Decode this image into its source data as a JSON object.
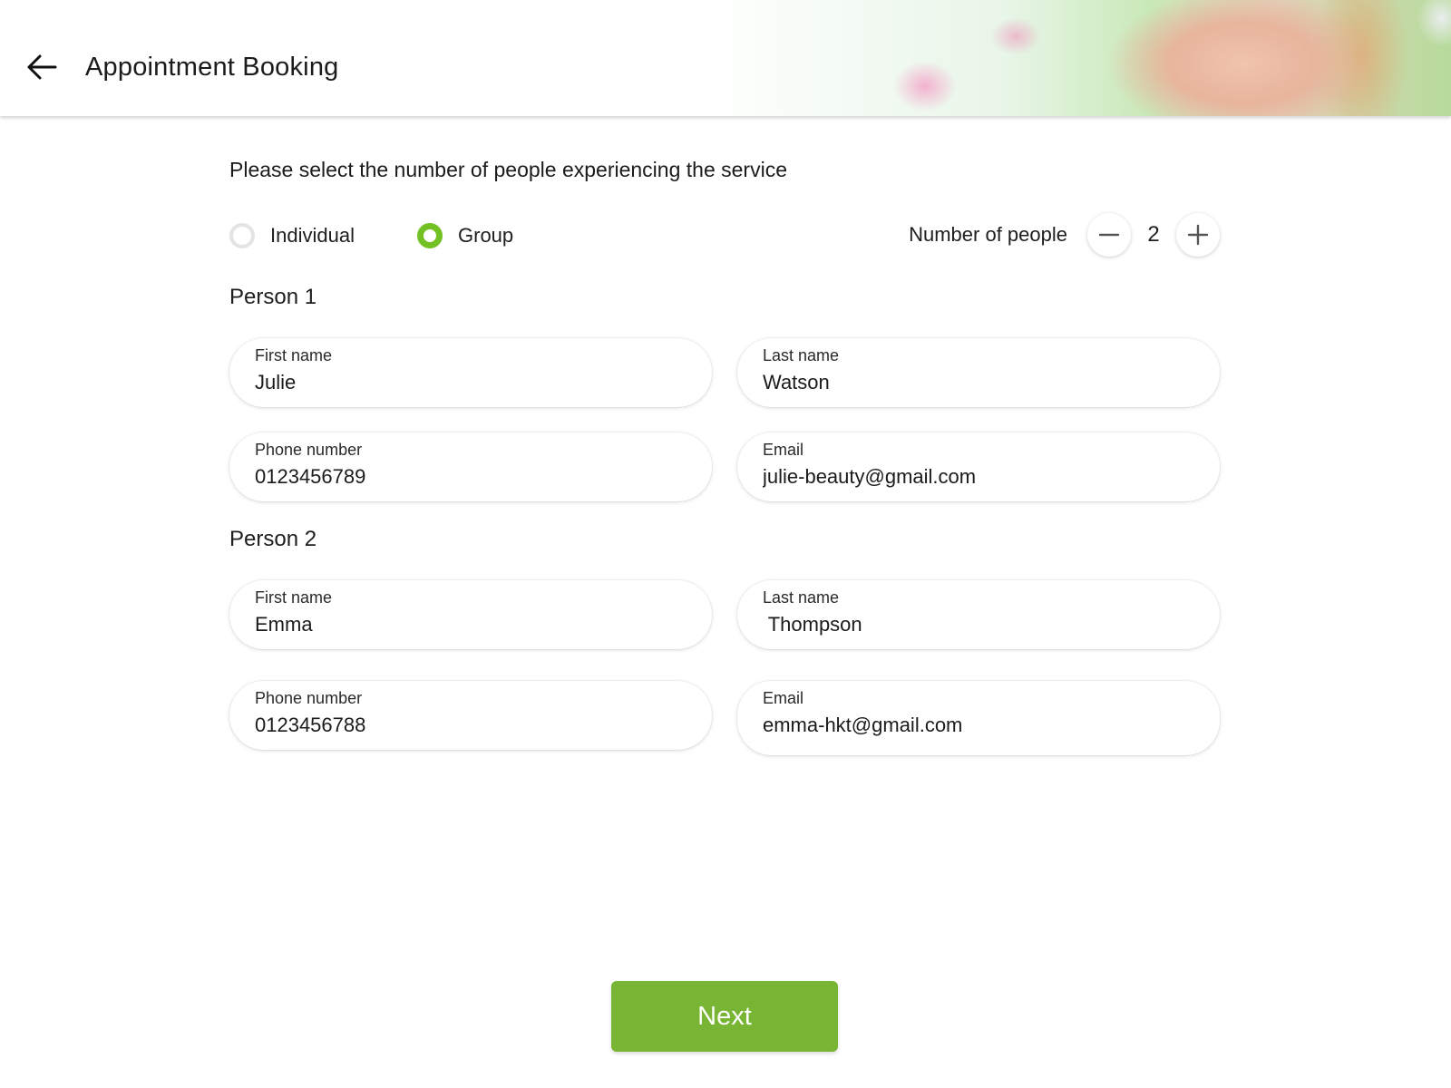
{
  "header": {
    "title": "Appointment Booking",
    "back_icon": "arrow-left-icon",
    "banner": "woman-with-flower-banner"
  },
  "prompt": "Please select the number of people experiencing the service",
  "booking_type": {
    "options": [
      {
        "label": "Individual",
        "selected": false
      },
      {
        "label": "Group",
        "selected": true
      }
    ],
    "accent_color": "#74c125"
  },
  "people_counter": {
    "label": "Number of people",
    "value": "2",
    "decrement_icon": "minus-icon",
    "increment_icon": "plus-icon"
  },
  "persons": [
    {
      "title": "Person 1",
      "first_name": {
        "label": "First name",
        "value": "Julie"
      },
      "last_name": {
        "label": "Last name",
        "value": "Watson"
      },
      "phone": {
        "label": "Phone number",
        "value": "0123456789"
      },
      "email": {
        "label": "Email",
        "value": "julie-beauty@gmail.com"
      }
    },
    {
      "title": "Person 2",
      "first_name": {
        "label": "First name",
        "value": "Emma"
      },
      "last_name": {
        "label": "Last name",
        "value": " Thompson"
      },
      "phone": {
        "label": "Phone number",
        "value": "0123456788"
      },
      "email": {
        "label": "Email",
        "value": "emma-hkt@gmail.com"
      }
    }
  ],
  "next_button": {
    "label": "Next",
    "color": "#78b535"
  }
}
